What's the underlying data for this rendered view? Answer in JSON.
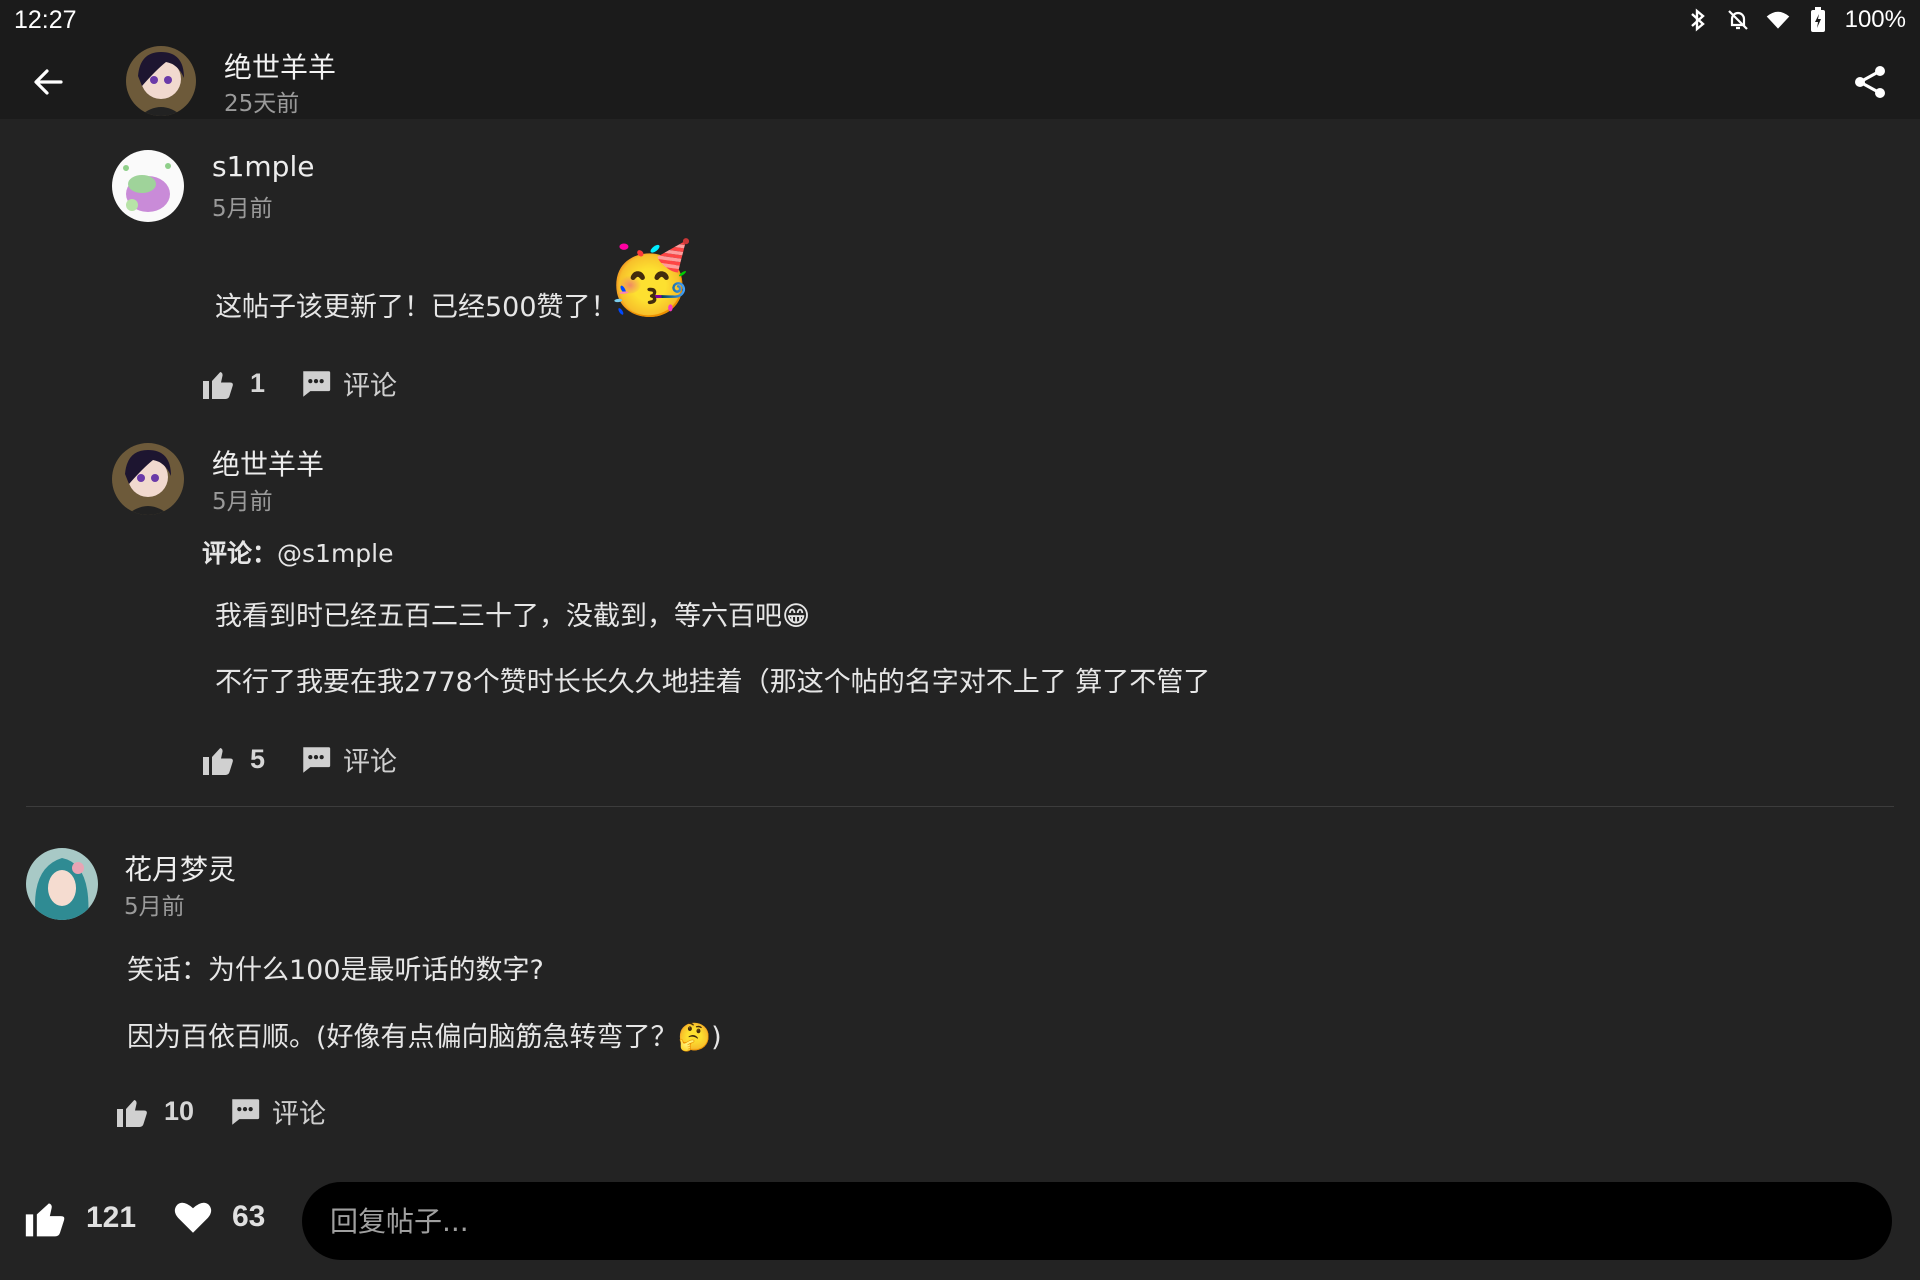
{
  "status_bar": {
    "time": "12:27",
    "battery": "100%"
  },
  "header": {
    "author": "绝世羊羊",
    "time": "25天前"
  },
  "comments": [
    {
      "user": "s1mple",
      "time": "5月前",
      "lines": [
        "这帖子该更新了！已经500赞了！"
      ],
      "emoji": "🥳",
      "likes": "1",
      "comment_label": "评论"
    },
    {
      "user": "绝世羊羊",
      "time": "5月前",
      "reply_prefix": "评论：",
      "reply_to": "@s1mple",
      "lines": [
        "我看到时已经五百二三十了，没截到，等六百吧😁",
        "不行了我要在我2778个赞时长长久久地挂着（那这个帖的名字对不上了 算了不管了"
      ],
      "likes": "5",
      "comment_label": "评论"
    },
    {
      "user": "花月梦灵",
      "time": "5月前",
      "lines": [
        "笑话：为什么100是最听话的数字?",
        "因为百依百顺。(好像有点偏向脑筋急转弯了？🤔)"
      ],
      "likes": "10",
      "comment_label": "评论"
    }
  ],
  "bottom_bar": {
    "likes": "121",
    "favorites": "63",
    "reply_placeholder": "回复帖子..."
  },
  "icons": [
    "back-arrow-icon",
    "share-icon",
    "thumbs-up-icon",
    "comment-bubble-icon",
    "heart-icon",
    "bluetooth-icon",
    "bell-off-icon",
    "wifi-icon",
    "battery-icon"
  ]
}
